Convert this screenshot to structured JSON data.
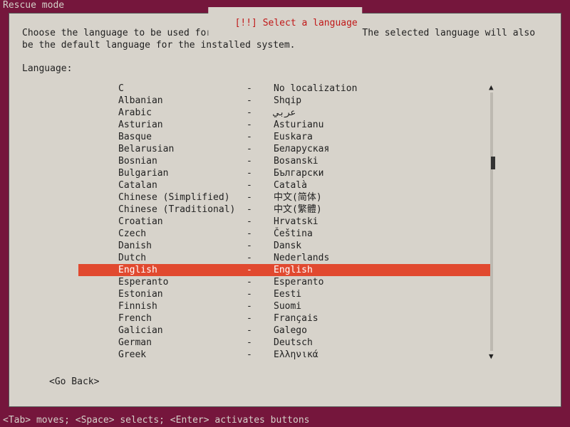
{
  "top_label": "Rescue mode",
  "dialog": {
    "title": "[!!] Select a language",
    "description": "Choose the language to be used for the installation process. The selected language will also be the default language for the installed system.",
    "field_label": "Language:",
    "go_back": "<Go Back>"
  },
  "selected_index": 15,
  "languages": [
    {
      "en": "C",
      "sep": "-",
      "native": "No localization"
    },
    {
      "en": "Albanian",
      "sep": "-",
      "native": "Shqip"
    },
    {
      "en": "Arabic",
      "sep": "-",
      "native": "عربي"
    },
    {
      "en": "Asturian",
      "sep": "-",
      "native": "Asturianu"
    },
    {
      "en": "Basque",
      "sep": "-",
      "native": "Euskara"
    },
    {
      "en": "Belarusian",
      "sep": "-",
      "native": "Беларуская"
    },
    {
      "en": "Bosnian",
      "sep": "-",
      "native": "Bosanski"
    },
    {
      "en": "Bulgarian",
      "sep": "-",
      "native": "Български"
    },
    {
      "en": "Catalan",
      "sep": "-",
      "native": "Català"
    },
    {
      "en": "Chinese (Simplified)",
      "sep": "-",
      "native": "中文(简体)"
    },
    {
      "en": "Chinese (Traditional)",
      "sep": "-",
      "native": "中文(繁體)"
    },
    {
      "en": "Croatian",
      "sep": "-",
      "native": "Hrvatski"
    },
    {
      "en": "Czech",
      "sep": "-",
      "native": "Čeština"
    },
    {
      "en": "Danish",
      "sep": "-",
      "native": "Dansk"
    },
    {
      "en": "Dutch",
      "sep": "-",
      "native": "Nederlands"
    },
    {
      "en": "English",
      "sep": "-",
      "native": "English"
    },
    {
      "en": "Esperanto",
      "sep": "-",
      "native": "Esperanto"
    },
    {
      "en": "Estonian",
      "sep": "-",
      "native": "Eesti"
    },
    {
      "en": "Finnish",
      "sep": "-",
      "native": "Suomi"
    },
    {
      "en": "French",
      "sep": "-",
      "native": "Français"
    },
    {
      "en": "Galician",
      "sep": "-",
      "native": "Galego"
    },
    {
      "en": "German",
      "sep": "-",
      "native": "Deutsch"
    },
    {
      "en": "Greek",
      "sep": "-",
      "native": "Ελληνικά"
    }
  ],
  "footer_help": "<Tab> moves; <Space> selects; <Enter> activates buttons"
}
